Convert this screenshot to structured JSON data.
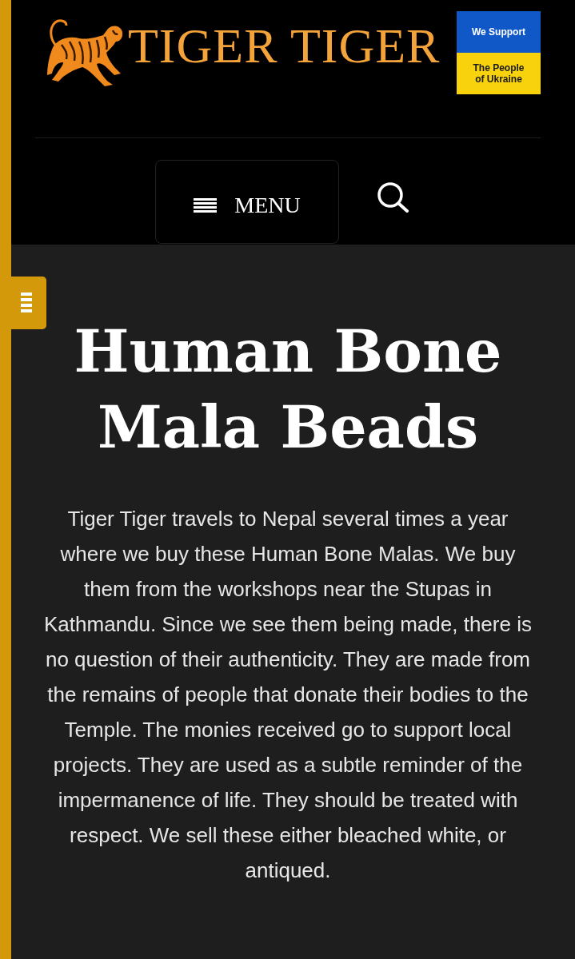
{
  "header": {
    "logo": {
      "text": "TIGER TIGER"
    },
    "badge": {
      "top": "We Support",
      "bottom": "The People of Ukraine"
    }
  },
  "nav": {
    "menu_button": {
      "label": "MENU"
    }
  },
  "page": {
    "title": "Human Bone Mala Beads",
    "body": "Tiger Tiger travels to Nepal several times a year where we buy these Human Bone Malas. We buy them from the workshops near the Stupas in Kathmandu. Since we see them being made, there is no question of their authenticity. They are made from the remains of people that donate their bodies to the Temple. The monies received go to support local projects. They are used as a subtle reminder of the impermanence of life. They should be treated with respect. We sell these either bleached white, or antiqued."
  }
}
